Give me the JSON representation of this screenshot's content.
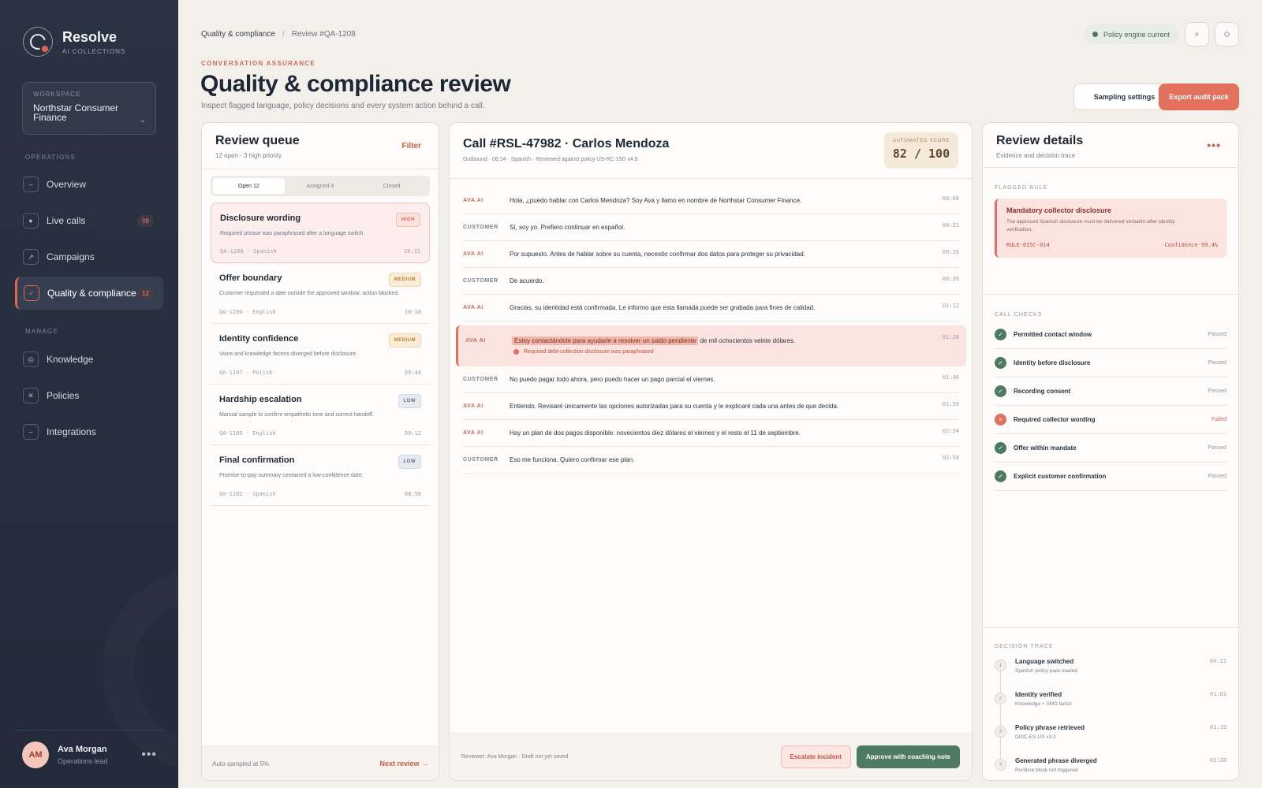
{
  "sidebar": {
    "brand": {
      "name": "Resolve",
      "sub": "AI COLLECTIONS"
    },
    "workspace": {
      "label": "WORKSPACE",
      "name": "Northstar Consumer Finance"
    },
    "operations_label": "OPERATIONS",
    "manage_label": "MANAGE",
    "items": [
      {
        "label": "Overview",
        "icon": "overview-icon",
        "glyph": "–"
      },
      {
        "label": "Live calls",
        "icon": "live-calls-icon",
        "glyph": "●",
        "badge": "08"
      },
      {
        "label": "Campaigns",
        "icon": "campaigns-icon",
        "glyph": "↗"
      },
      {
        "label": "Quality & compliance",
        "icon": "check-icon",
        "glyph": "✓",
        "badge": "12"
      },
      {
        "label": "Knowledge",
        "icon": "knowledge-icon",
        "glyph": "◎"
      },
      {
        "label": "Policies",
        "icon": "policies-icon",
        "glyph": "✕"
      },
      {
        "label": "Integrations",
        "icon": "integrations-icon",
        "glyph": "–"
      }
    ],
    "user": {
      "initials": "AM",
      "name": "Ava Morgan",
      "role": "Operations lead",
      "more": "•••"
    }
  },
  "header": {
    "breadcrumb": [
      "Quality & compliance",
      "/",
      "Review #QA-1208"
    ],
    "policy_status": "Policy engine current",
    "eyebrow": "CONVERSATION ASSURANCE",
    "title": "Quality & compliance review",
    "subtitle": "Inspect flagged language, policy decisions and every system action behind a call.",
    "sampling_button": "Sampling settings",
    "export_button": "Export audit pack",
    "search_glyph": "⌕",
    "settings_glyph": "◇"
  },
  "queue": {
    "title": "Review queue",
    "subtitle": "12 open · 3 high priority",
    "filter": "Filter",
    "tabs": [
      "Open 12",
      "Assigned 4",
      "Closed"
    ],
    "items": [
      {
        "title": "Disclosure wording",
        "priority": "HIGH",
        "desc": "Required phrase was paraphrased after a language switch.",
        "meta": "QA-1208 · Spanish",
        "time": "10:31"
      },
      {
        "title": "Offer boundary",
        "priority": "MEDIUM",
        "desc": "Customer requested a date outside the approved window; action blocked.",
        "meta": "QA-1204 · English",
        "time": "10:18"
      },
      {
        "title": "Identity confidence",
        "priority": "MEDIUM",
        "desc": "Voice and knowledge factors diverged before disclosure.",
        "meta": "QA-1197 · Polish",
        "time": "09:44"
      },
      {
        "title": "Hardship escalation",
        "priority": "LOW",
        "desc": "Manual sample to confirm empathetic tone and correct handoff.",
        "meta": "QA-1189 · English",
        "time": "09:12"
      },
      {
        "title": "Final confirmation",
        "priority": "LOW",
        "desc": "Promise-to-pay summary contained a low-confidence date.",
        "meta": "QA-1182 · Spanish",
        "time": "08:56"
      }
    ],
    "footer_note": "Auto-sampled at 5%",
    "next": "Next review →"
  },
  "call": {
    "title": "Call #RSL-47982 · Carlos Mendoza",
    "subtitle": "Outbound · 06:14 · Spanish · Reviewed against policy US-RC-15D v4.8",
    "score_label": "AUTOMATED SCORE",
    "score": "82 / 100",
    "lines": [
      {
        "speaker": "AVA AI",
        "text": "Hola, ¿puedo hablar con Carlos Mendoza? Soy Ava y llamo en nombre de Northstar Consumer Finance.",
        "time": "00:08"
      },
      {
        "speaker": "CUSTOMER",
        "text": "Sí, soy yo. Prefiero continuar en español.",
        "time": "00:21"
      },
      {
        "speaker": "AVA AI",
        "text": "Por supuesto. Antes de hablar sobre su cuenta, necesito confirmar dos datos para proteger su privacidad.",
        "time": "00:26"
      },
      {
        "speaker": "CUSTOMER",
        "text": "De acuerdo.",
        "time": "00:39"
      },
      {
        "speaker": "AVA AI",
        "text": "Gracias, su identidad está confirmada. Le informo que esta llamada puede ser grabada para fines de calidad.",
        "time": "01:12"
      }
    ],
    "flagged": {
      "speaker": "AVA AI",
      "highlight": "Estoy contactándole para ayudarle a resolver un saldo pendiente",
      "rest": " de mil ochocientos veinte dólares.",
      "time": "01:28",
      "note": "Required debt-collection disclosure was paraphrased"
    },
    "lines_after": [
      {
        "speaker": "CUSTOMER",
        "text": "No puedo pagar todo ahora, pero puedo hacer un pago parcial el viernes.",
        "time": "01:46"
      },
      {
        "speaker": "AVA AI",
        "text": "Entiendo. Revisaré únicamente las opciones autorizadas para su cuenta y le explicaré cada una antes de que decida.",
        "time": "01:59"
      },
      {
        "speaker": "AVA AI",
        "text": "Hay un plan de dos pagos disponible: novecientos diez dólares el viernes y el resto el 11 de septiembre.",
        "time": "02:34"
      },
      {
        "speaker": "CUSTOMER",
        "text": "Eso me funciona. Quiero confirmar ese plan.",
        "time": "02:58"
      }
    ],
    "footer_note": "Reviewer: Ava Morgan · Draft not yet saved",
    "escalate": "Escalate incident",
    "approve": "Approve with coaching note"
  },
  "details": {
    "title": "Review details",
    "subtitle": "Evidence and decision trace",
    "more": "•••",
    "flagged_label": "FLAGGED RULE",
    "rule": {
      "title": "Mandatory collector disclosure",
      "desc": "The approved Spanish disclosure must be delivered verbatim after identity verification.",
      "id": "RULE-DISC-014",
      "confidence": "Confidence 99.4%"
    },
    "checks_label": "CALL CHECKS",
    "checks": [
      {
        "label": "Permitted contact window",
        "status": "Passed",
        "glyph": "✓"
      },
      {
        "label": "Identity before disclosure",
        "status": "Passed",
        "glyph": "✓"
      },
      {
        "label": "Recording consent",
        "status": "Passed",
        "glyph": "✓"
      },
      {
        "label": "Required collector wording",
        "status": "Failed",
        "glyph": "×"
      },
      {
        "label": "Offer within mandate",
        "status": "Passed",
        "glyph": "✓"
      },
      {
        "label": "Explicit customer confirmation",
        "status": "Passed",
        "glyph": "✓"
      }
    ],
    "trace_label": "DECISION TRACE",
    "trace": [
      {
        "n": "1",
        "title": "Language switched",
        "sub": "Spanish policy pack loaded",
        "time": "00:21"
      },
      {
        "n": "2",
        "title": "Identity verified",
        "sub": "Knowledge + SMS factor",
        "time": "01:03"
      },
      {
        "n": "3",
        "title": "Policy phrase retrieved",
        "sub": "DISC-ES-US v3.2",
        "time": "01:19"
      },
      {
        "n": "4",
        "title": "Generated phrase diverged",
        "sub": "Runtime block not triggered",
        "time": "01:28"
      }
    ]
  },
  "colors": {
    "accent": "#e2705c",
    "success": "#4f7a62",
    "sidebar": "#272e3d"
  }
}
